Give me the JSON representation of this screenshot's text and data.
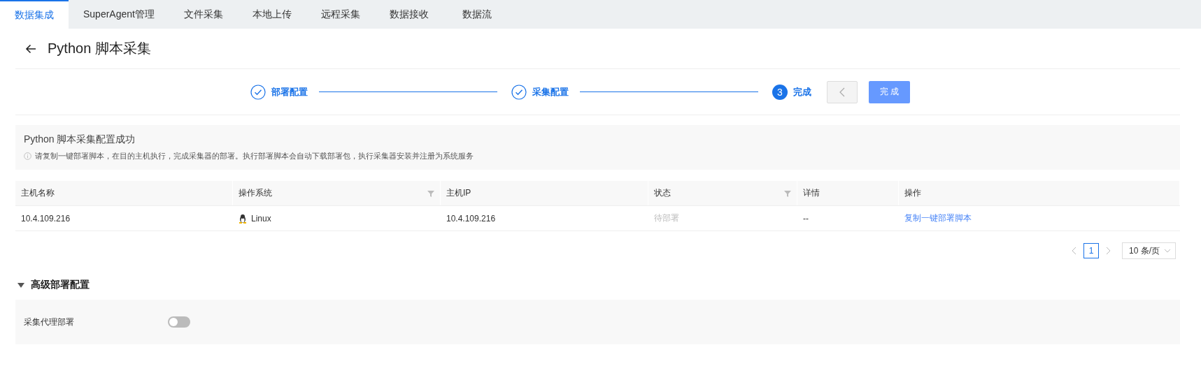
{
  "tabs": [
    {
      "label": "数据集成",
      "selected": true
    },
    {
      "label": "SuperAgent管理",
      "selected": false
    },
    {
      "label": "文件采集",
      "selected": false
    },
    {
      "label": "本地上传",
      "selected": false
    },
    {
      "label": "远程采集",
      "selected": false
    },
    {
      "label": "数据接收",
      "selected": false
    },
    {
      "label": "数据流",
      "selected": false
    }
  ],
  "page_title": "Python 脚本采集",
  "steps": [
    {
      "label": "部署配置",
      "done": true
    },
    {
      "label": "采集配置",
      "done": true
    },
    {
      "label": "完成",
      "done": false,
      "number": "3"
    }
  ],
  "back_button": {
    "disabled": true
  },
  "finish_button": {
    "label": "完 成"
  },
  "notice": {
    "title": "Python 脚本采集配置成功",
    "text": "请复制一键部署脚本，在目的主机执行，完成采集器的部署。执行部署脚本会自动下载部署包，执行采集器安装并注册为系统服务"
  },
  "table": {
    "columns": [
      {
        "label": "主机名称",
        "filter": false
      },
      {
        "label": "操作系统",
        "filter": true
      },
      {
        "label": "主机IP",
        "filter": false
      },
      {
        "label": "状态",
        "filter": true
      },
      {
        "label": "详情",
        "filter": false
      },
      {
        "label": "操作",
        "filter": false
      }
    ],
    "rows": [
      {
        "cells": [
          {
            "kind": "text",
            "text": "10.4.109.216"
          },
          {
            "kind": "os",
            "text": "Linux"
          },
          {
            "kind": "text",
            "text": "10.4.109.216"
          },
          {
            "kind": "muted",
            "text": "待部署"
          },
          {
            "kind": "text",
            "text": "--"
          },
          {
            "kind": "link",
            "text": "复制一键部署脚本"
          }
        ]
      }
    ]
  },
  "pagination": {
    "pages": [
      {
        "label": "1",
        "selected": true
      }
    ],
    "page_size": "10 条/页"
  },
  "advanced": {
    "title": "高级部署配置",
    "expanded": true,
    "fields": [
      {
        "label": "采集代理部署",
        "on": false
      }
    ]
  }
}
